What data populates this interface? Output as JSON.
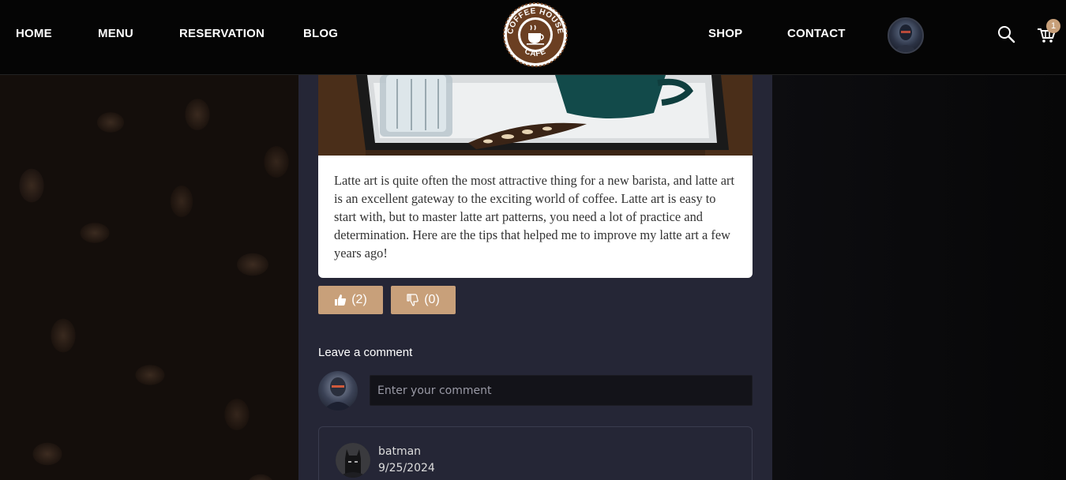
{
  "nav": {
    "home": "HOME",
    "menu": "MENU",
    "reservation": "RESERVATION",
    "blog": "BLOG",
    "shop": "SHOP",
    "contact": "CONTACT"
  },
  "logo": {
    "top_text": "COFFEE HOUSE",
    "bottom_text": "CAFE"
  },
  "cart": {
    "count": "1"
  },
  "post": {
    "text": "Latte art is quite often the most attractive thing for a new barista, and latte art is an excellent gateway to the exciting world of coffee. Latte art is easy to start with, but to master latte art patterns, you need a lot of practice and determination. Here are the tips that helped me to improve my latte art a few years ago!",
    "likes": "(2)",
    "dislikes": "(0)"
  },
  "comments": {
    "heading": "Leave a comment",
    "placeholder": "Enter your comment",
    "items": [
      {
        "user": "batman",
        "date": "9/25/2024"
      }
    ]
  },
  "colors": {
    "accent": "#c8a07a",
    "column_bg": "#252636",
    "header_bg": "#050505"
  }
}
